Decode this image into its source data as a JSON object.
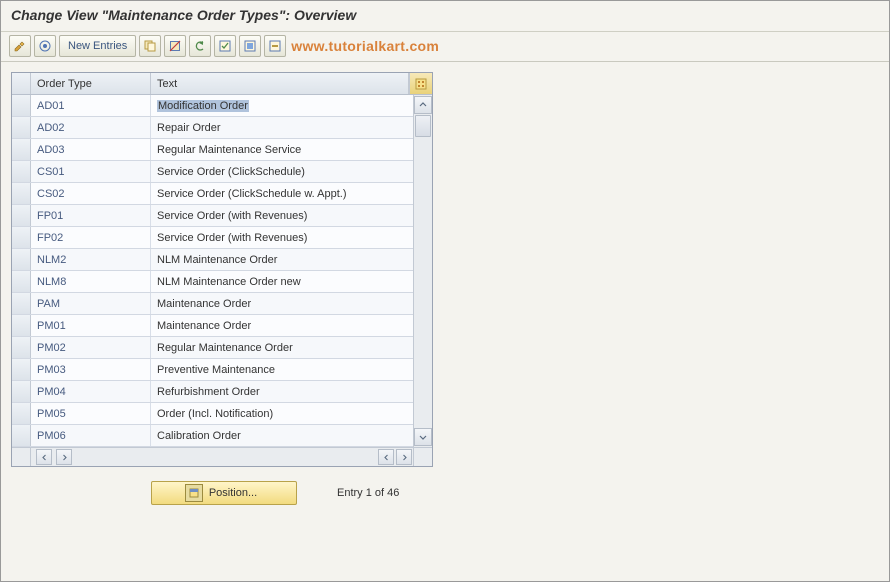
{
  "title": "Change View \"Maintenance Order Types\": Overview",
  "toolbar": {
    "new_entries_label": "New Entries"
  },
  "watermark": "www.tutorialkart.com",
  "columns": {
    "order_type": "Order Type",
    "text": "Text"
  },
  "rows": [
    {
      "order_type": "AD01",
      "text": "Modification Order",
      "selected": true
    },
    {
      "order_type": "AD02",
      "text": "Repair Order"
    },
    {
      "order_type": "AD03",
      "text": "Regular Maintenance Service"
    },
    {
      "order_type": "CS01",
      "text": "Service Order (ClickSchedule)"
    },
    {
      "order_type": "CS02",
      "text": "Service Order (ClickSchedule w. Appt.)"
    },
    {
      "order_type": "FP01",
      "text": "Service Order (with Revenues)"
    },
    {
      "order_type": "FP02",
      "text": "Service Order (with Revenues)"
    },
    {
      "order_type": "NLM2",
      "text": "NLM Maintenance Order"
    },
    {
      "order_type": "NLM8",
      "text": "NLM Maintenance Order new"
    },
    {
      "order_type": "PAM",
      "text": "Maintenance Order"
    },
    {
      "order_type": "PM01",
      "text": "Maintenance Order"
    },
    {
      "order_type": "PM02",
      "text": "Regular Maintenance Order"
    },
    {
      "order_type": "PM03",
      "text": "Preventive Maintenance"
    },
    {
      "order_type": "PM04",
      "text": "Refurbishment Order"
    },
    {
      "order_type": "PM05",
      "text": "Order (Incl. Notification)"
    },
    {
      "order_type": "PM06",
      "text": "Calibration Order"
    }
  ],
  "footer": {
    "position_label": "Position...",
    "entry_info": "Entry 1 of 46"
  }
}
